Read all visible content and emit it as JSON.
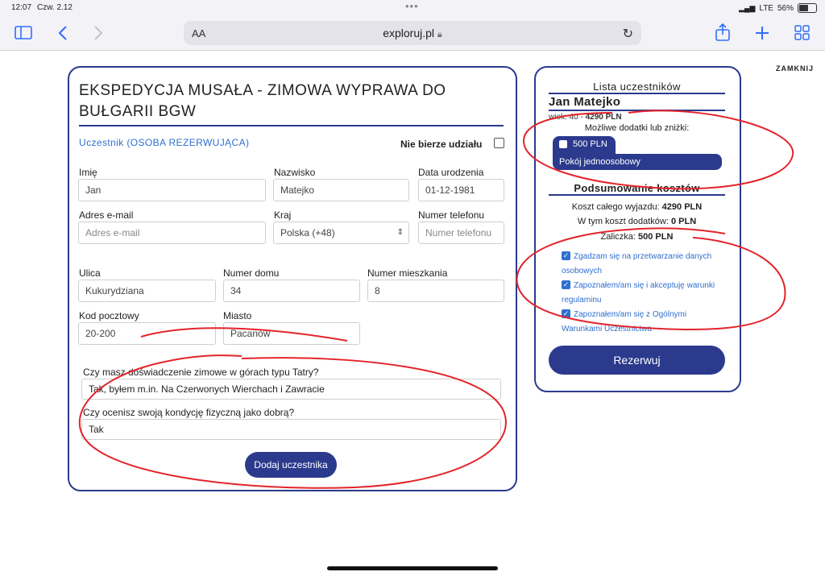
{
  "status_bar": {
    "time": "12:07",
    "date": "Czw. 2.12",
    "network": "LTE",
    "battery": "56%"
  },
  "browser": {
    "aa": "AA",
    "url": "exploruj.pl"
  },
  "close_label": "ZAMKNIJ",
  "form": {
    "title": "EKSPEDYCJA MUSAŁA - ZIMOWA WYPRAWA DO BUŁGARII BGW",
    "section_label": "Uczestnik (OSOBA REZERWUJĄCA)",
    "not_participating_label": "Nie bierze udziału",
    "fields": {
      "first_name": {
        "label": "Imię",
        "value": "Jan"
      },
      "last_name": {
        "label": "Nazwisko",
        "value": "Matejko"
      },
      "birth_date": {
        "label": "Data urodzenia",
        "value": "01-12-1981"
      },
      "email": {
        "label": "Adres e-mail",
        "placeholder": "Adres e-mail"
      },
      "country": {
        "label": "Kraj",
        "value": "Polska (+48)"
      },
      "phone": {
        "label": "Numer telefonu",
        "placeholder": "Numer telefonu"
      },
      "street": {
        "label": "Ulica",
        "value": "Kukurydziana"
      },
      "house_number": {
        "label": "Numer domu",
        "value": "34"
      },
      "apartment_number": {
        "label": "Numer mieszkania",
        "value": "8"
      },
      "postal_code": {
        "label": "Kod pocztowy",
        "value": "20-200"
      },
      "city": {
        "label": "Miasto",
        "value": "Pacanów"
      }
    },
    "questions": [
      {
        "label": "Czy masz doświadczenie zimowe w górach typu Tatry?",
        "value": "Tak, byłem m.in. Na Czerwonych Wierchach i Zawracie"
      },
      {
        "label": "Czy ocenisz swoją kondycję fizyczną jako dobrą?",
        "value": "Tak"
      }
    ],
    "add_participant_button": "Dodaj uczestnika"
  },
  "sidebar": {
    "participants_title": "Lista uczestników",
    "participant_name": "Jan Matejko",
    "participant_age_prefix": "wiek: 40 - ",
    "participant_price": "4290 PLN",
    "addons_title": "Możliwe dodatki lub zniżki:",
    "addon_price": "500 PLN",
    "addon_name": "Pokój jednoosobowy",
    "summary_title": "Podsumowanie kosztów",
    "total_label": "Koszt całego wyjazdu: ",
    "total_value": "4290 PLN",
    "addons_cost_label": "W tym koszt dodatków: ",
    "addons_cost_value": "0 PLN",
    "deposit_label": "Zaliczka: ",
    "deposit_value": "500 PLN",
    "consents": [
      {
        "line1": "Zgadzam się na przetwarzanie danych",
        "line2": "osobowych"
      },
      {
        "line1": "Zapoznałem/am się i akceptuję warunki",
        "line2": "regulaminu"
      },
      {
        "line1": "Zapoznałem/am się z Ogólnymi",
        "line2": "Warunkami Uczestnictwa"
      }
    ],
    "reserve_button": "Rezerwuj"
  },
  "colors": {
    "brand": "#2b3a8d",
    "link": "#2f6fd0",
    "annotation": "#e3242b"
  }
}
